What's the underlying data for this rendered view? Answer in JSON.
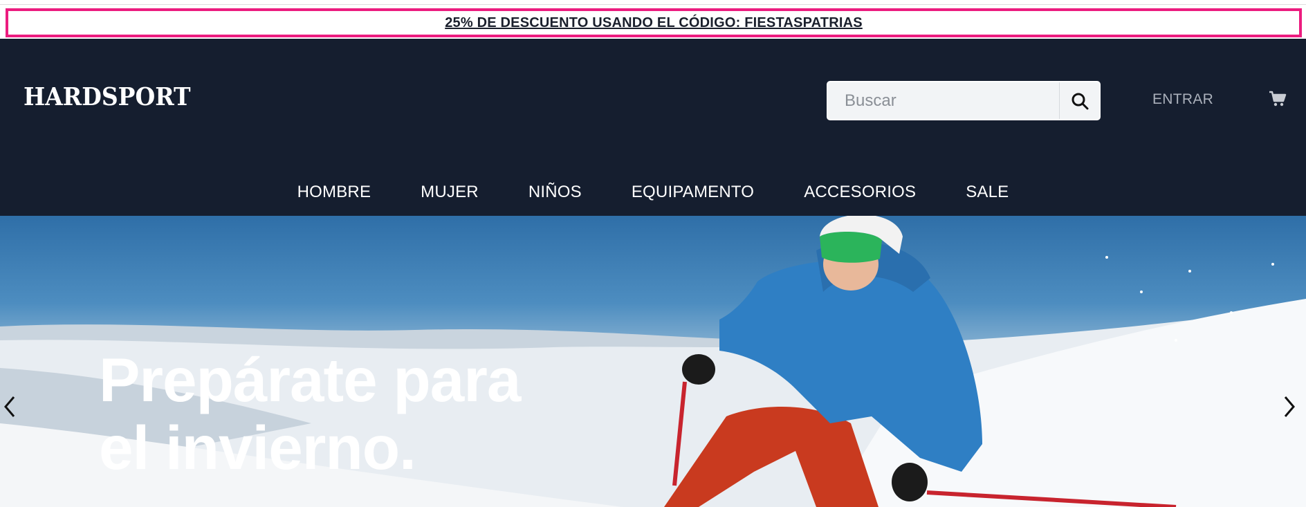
{
  "promo": {
    "text": "25% DE DESCUENTO USANDO EL CÓDIGO: FIESTASPATRIAS"
  },
  "header": {
    "logo": "HARDSPORT",
    "search": {
      "placeholder": "Buscar",
      "value": "",
      "icon": "search-icon"
    },
    "login_label": "ENTRAR",
    "cart_icon": "cart-icon"
  },
  "nav": {
    "items": [
      {
        "label": "HOMBRE"
      },
      {
        "label": "MUJER"
      },
      {
        "label": "NIÑOS"
      },
      {
        "label": "EQUIPAMENTO"
      },
      {
        "label": "ACCESORIOS"
      },
      {
        "label": "SALE"
      }
    ]
  },
  "hero": {
    "title_line1": "Prepárate para",
    "title_line2": "el invierno.",
    "prev_icon": "chevron-left-icon",
    "next_icon": "chevron-right-icon"
  },
  "colors": {
    "promo_border": "#ec1c7f",
    "header_bg": "#151e2f",
    "text_dark": "#1a1f2c"
  }
}
